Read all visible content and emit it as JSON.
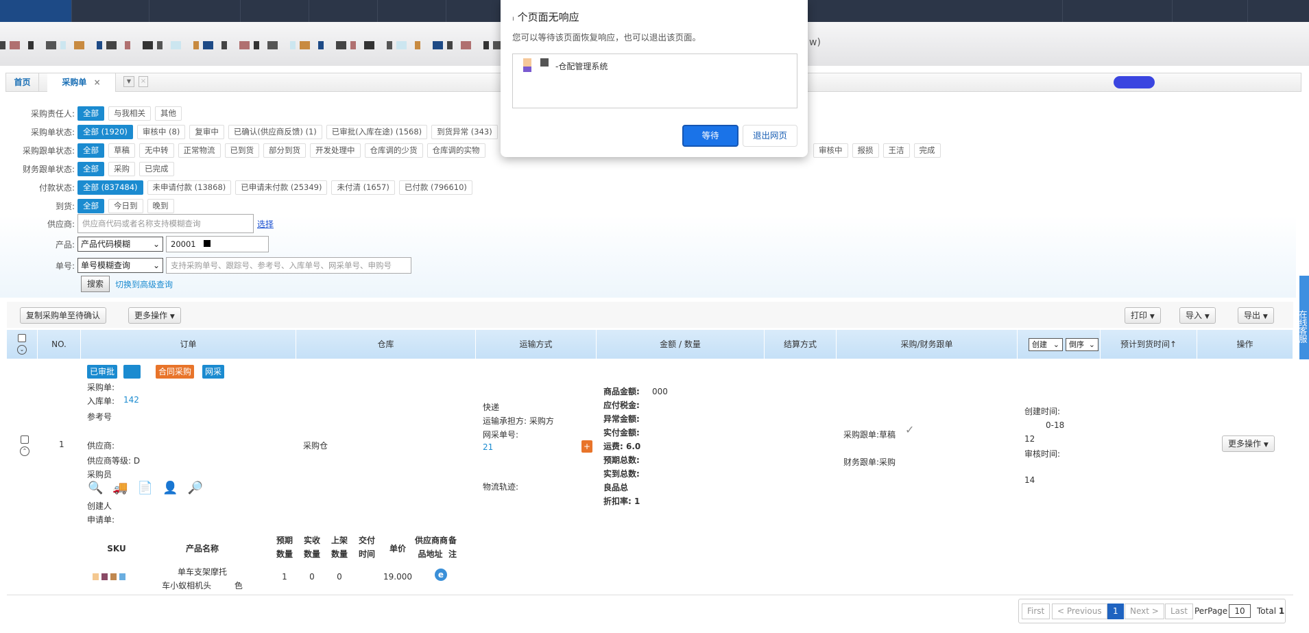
{
  "dialog": {
    "title": "个页面无响应",
    "title_prefix": "ı",
    "message": "您可以等待该页面恢复响应，也可以退出该页面。",
    "page_name": "-仓配管理系统",
    "wait_label": "等待",
    "exit_label": "退出网页",
    "accent": "#1a73e8"
  },
  "browser": {
    "address_suffix": "w)"
  },
  "tabs": [
    {
      "label": "首页"
    },
    {
      "label": "采购单",
      "close": "×"
    }
  ],
  "filters": {
    "owner": {
      "label": "采购责任人:",
      "options": [
        "全部",
        "与我相关",
        "其他"
      ]
    },
    "order_status": {
      "label": "采购单状态:",
      "options": [
        "全部 (1920)",
        "审核中 (8)",
        "复审中",
        "已确认(供应商反馈) (1)",
        "已审批(入库在途) (1568)",
        "到货异常 (343)"
      ]
    },
    "follow_status": {
      "label": "采购跟单状态:",
      "options": [
        "全部",
        "草稿",
        "无中转",
        "正常物流",
        "已到货",
        "部分到货",
        "开发处理中",
        "仓库调的少货",
        "仓库调的实物"
      ],
      "options_right": [
        "审核中",
        "报损",
        "王洁",
        "完成"
      ]
    },
    "finance_status": {
      "label": "财务跟单状态:",
      "options": [
        "全部",
        "采购",
        "已完成"
      ]
    },
    "payment_status": {
      "label": "付款状态:",
      "options": [
        "全部 (837484)",
        "未申请付款 (13868)",
        "已申请未付款 (25349)",
        "未付清 (1657)",
        "已付款 (796610)"
      ]
    },
    "arrival": {
      "label": "到货:",
      "options": [
        "全部",
        "今日到",
        "晚到"
      ]
    },
    "supplier": {
      "label": "供应商:",
      "placeholder": "供应商代码或者名称支持模糊查询",
      "select_link": "选择"
    },
    "product": {
      "label": "产品:",
      "mode": "产品代码模糊",
      "value": "20001"
    },
    "order_no": {
      "label": "单号:",
      "mode": "单号模糊查询",
      "placeholder": "支持采购单号、跟踪号、参考号、入库单号、网采单号、申购号"
    },
    "search_label": "搜索",
    "advanced_link": "切换到高级查询"
  },
  "toolbar": {
    "copy_label": "复制采购单至待确认",
    "more_label": "更多操作",
    "print_label": "打印",
    "import_label": "导入",
    "export_label": "导出"
  },
  "side_tab": "在线客服",
  "table": {
    "headers": {
      "no": "NO.",
      "order": "订单",
      "warehouse": "仓库",
      "shipping": "运输方式",
      "amount": "金额 / 数量",
      "settlement": "结算方式",
      "follow": "采购/财务跟单",
      "sort_field": "创建",
      "sort_order": "倒序",
      "eta": "预计到货时间↑",
      "ops": "操作"
    },
    "rows": [
      {
        "no": "1",
        "badges": [
          {
            "text": "已审批",
            "color": "#1b8bd0"
          },
          {
            "text": "合同采购",
            "color": "#e8742a"
          },
          {
            "text": "网采",
            "color": "#1b8bd0"
          }
        ],
        "order_labels": {
          "po": "采购单:",
          "inbound": "入库单:",
          "inbound_frag": "142",
          "ref": "参考号",
          "supplier": "供应商:",
          "grade": "供应商等级: D",
          "buyer": "采购员",
          "creator": "创建人",
          "request": "申请单:"
        },
        "warehouse": "采购仓",
        "shipping": {
          "method": "快递",
          "bearer": "运输承担方: 采购方",
          "net_no": "网采单号:",
          "net_frag": "21",
          "tracking": "物流轨迹:"
        },
        "amount": {
          "goods": "商品金额:",
          "goods_frag": "000",
          "tax": "应付税金:",
          "abnormal": "异常金额:",
          "paid": "实付金额:",
          "freight": "运费: 6.0",
          "expected": "预期总数:",
          "received": "实到总数:",
          "good_total": "良品总",
          "discount": "折扣率: 1"
        },
        "follow": {
          "purchase": "采购跟单:草稿",
          "finance": "财务跟单:采购"
        },
        "times": {
          "created_label": "创建时间:",
          "created_frag1": "0-18",
          "created_frag2": "12",
          "audit_label": "审核时间:",
          "audit_frag": "14"
        },
        "ops_label": "更多操作",
        "items": {
          "headers": [
            "SKU",
            "产品名称",
            "预期\n数量",
            "实收\n数量",
            "上架\n数量",
            "交付\n时间",
            "单价",
            "供应商商\n品地址",
            "备\n注"
          ],
          "rows": [
            {
              "name_line1": "单车支架摩托",
              "name_line2": "车小蚁相机头",
              "name_suffix": "色",
              "expected": "1",
              "received": "0",
              "shelved": "0",
              "delivery": "",
              "price": "19.000"
            }
          ]
        }
      }
    ]
  },
  "pagination": {
    "first": "First",
    "prev": "< Previous",
    "current": "1",
    "next": "Next >",
    "last": "Last",
    "per_page_label": "PerPage",
    "per_page": "10",
    "total_label": "Total",
    "total": "1"
  }
}
